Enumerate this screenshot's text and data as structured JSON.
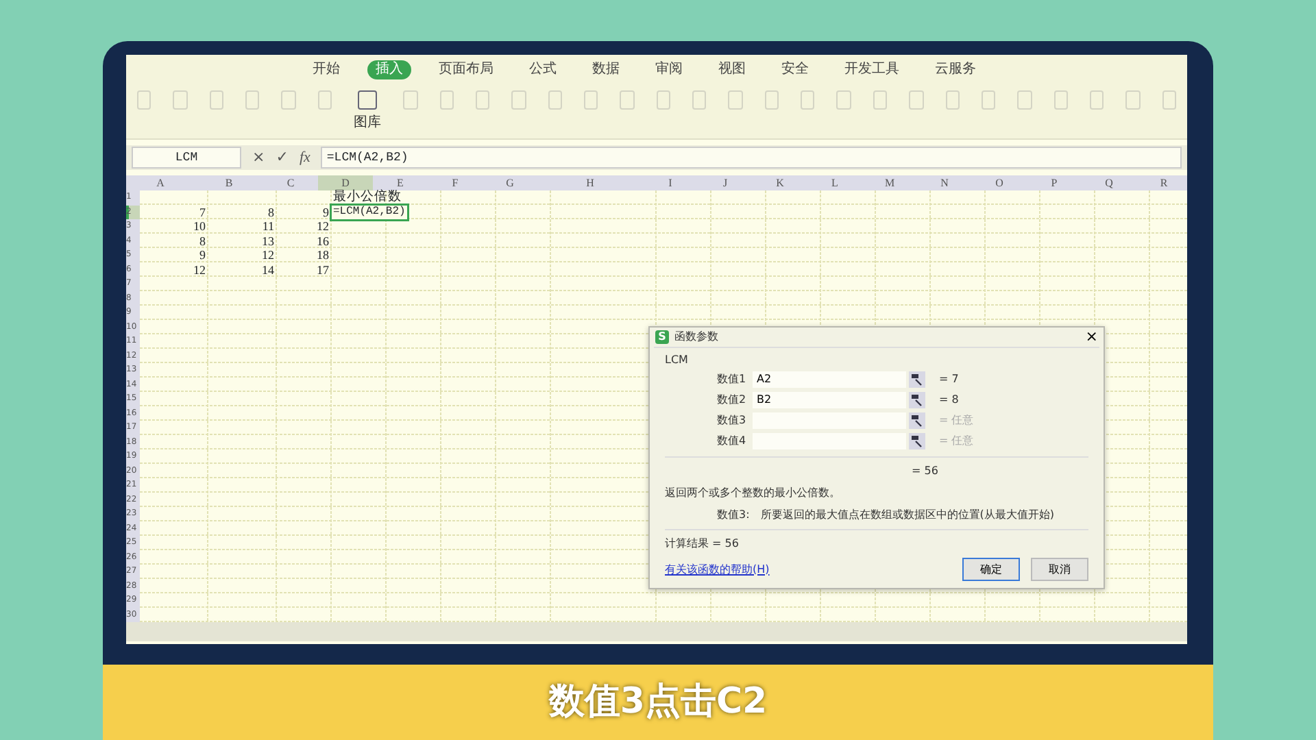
{
  "menu_tabs": [
    {
      "label": "开始",
      "selected": false
    },
    {
      "label": "插入",
      "selected": true
    },
    {
      "label": "页面布局",
      "selected": false
    },
    {
      "label": "公式",
      "selected": false
    },
    {
      "label": "数据",
      "selected": false
    },
    {
      "label": "审阅",
      "selected": false
    },
    {
      "label": "视图",
      "selected": false
    },
    {
      "label": "安全",
      "selected": false
    },
    {
      "label": "开发工具",
      "selected": false
    },
    {
      "label": "云服务",
      "selected": false
    }
  ],
  "ribbon": {
    "labels": [
      "图库"
    ]
  },
  "formula_bar": {
    "name_box": "LCM",
    "cancel": "×",
    "confirm": "✓",
    "fx": "fx",
    "formula": "=LCM(A2,B2)"
  },
  "sheet": {
    "columns": [
      {
        "label": "A",
        "selected": false
      },
      {
        "label": "B",
        "selected": false
      },
      {
        "label": "C",
        "selected": false
      },
      {
        "label": "D",
        "selected": true
      },
      {
        "label": "E",
        "selected": false
      },
      {
        "label": "F",
        "selected": false
      },
      {
        "label": "G",
        "selected": false
      },
      {
        "label": "H",
        "selected": false
      },
      {
        "label": "I",
        "selected": false
      },
      {
        "label": "J",
        "selected": false
      },
      {
        "label": "K",
        "selected": false
      },
      {
        "label": "L",
        "selected": false
      },
      {
        "label": "M",
        "selected": false
      },
      {
        "label": "N",
        "selected": false
      },
      {
        "label": "O",
        "selected": false
      },
      {
        "label": "P",
        "selected": false
      },
      {
        "label": "Q",
        "selected": false
      },
      {
        "label": "R",
        "selected": false
      }
    ],
    "rows": [
      {
        "header": "1",
        "selected": false,
        "cells": [
          null,
          null,
          null,
          {
            "text": "最小公倍数",
            "selected": false
          }
        ]
      },
      {
        "header": "2",
        "selected": true,
        "cells": [
          {
            "text": "7",
            "selected": false
          },
          {
            "text": "8",
            "selected": false
          },
          {
            "text": "9",
            "selected": false
          },
          {
            "text": "=LCM(A2,B2)",
            "selected": true
          }
        ]
      },
      {
        "header": "3",
        "selected": false,
        "cells": [
          {
            "text": "10",
            "selected": false
          },
          {
            "text": "11",
            "selected": false
          },
          {
            "text": "12",
            "selected": false
          }
        ]
      },
      {
        "header": "4",
        "selected": false,
        "cells": [
          {
            "text": "8",
            "selected": false
          },
          {
            "text": "13",
            "selected": false
          },
          {
            "text": "16",
            "selected": false
          }
        ]
      },
      {
        "header": "5",
        "selected": false,
        "cells": [
          {
            "text": "9",
            "selected": false
          },
          {
            "text": "12",
            "selected": false
          },
          {
            "text": "18",
            "selected": false
          }
        ]
      },
      {
        "header": "6",
        "selected": false,
        "cells": [
          {
            "text": "12",
            "selected": false
          },
          {
            "text": "14",
            "selected": false
          },
          {
            "text": "17",
            "selected": false
          }
        ]
      },
      {
        "header": "7",
        "selected": false,
        "cells": []
      },
      {
        "header": "8",
        "selected": false,
        "cells": []
      },
      {
        "header": "9",
        "selected": false,
        "cells": []
      },
      {
        "header": "10",
        "selected": false,
        "cells": []
      },
      {
        "header": "11",
        "selected": false,
        "cells": []
      },
      {
        "header": "12",
        "selected": false,
        "cells": []
      },
      {
        "header": "13",
        "selected": false,
        "cells": []
      },
      {
        "header": "14",
        "selected": false,
        "cells": []
      },
      {
        "header": "15",
        "selected": false,
        "cells": []
      },
      {
        "header": "16",
        "selected": false,
        "cells": []
      },
      {
        "header": "17",
        "selected": false,
        "cells": []
      },
      {
        "header": "18",
        "selected": false,
        "cells": []
      },
      {
        "header": "19",
        "selected": false,
        "cells": []
      },
      {
        "header": "20",
        "selected": false,
        "cells": []
      },
      {
        "header": "21",
        "selected": false,
        "cells": []
      },
      {
        "header": "22",
        "selected": false,
        "cells": []
      },
      {
        "header": "23",
        "selected": false,
        "cells": []
      },
      {
        "header": "24",
        "selected": false,
        "cells": []
      },
      {
        "header": "25",
        "selected": false,
        "cells": []
      },
      {
        "header": "26",
        "selected": false,
        "cells": []
      },
      {
        "header": "27",
        "selected": false,
        "cells": []
      },
      {
        "header": "28",
        "selected": false,
        "cells": []
      },
      {
        "header": "29",
        "selected": false,
        "cells": []
      },
      {
        "header": "30",
        "selected": false,
        "cells": []
      }
    ]
  },
  "dialog": {
    "icon_letter": "S",
    "title": "函数参数",
    "close": "×",
    "function_name": "LCM",
    "args": [
      {
        "label": "数值1",
        "value": "A2",
        "result": "= 7",
        "dimmed": false
      },
      {
        "label": "数值2",
        "value": "B2",
        "result": "= 8",
        "dimmed": false
      },
      {
        "label": "数值3",
        "result": "= 任意",
        "dimmed": true
      },
      {
        "label": "数值4",
        "result": "= 任意",
        "dimmed": true
      }
    ],
    "result_line": "= 56",
    "description": "返回两个或多个整数的最小公倍数。",
    "arg_help_label": "数值3:",
    "arg_help": "所要返回的最大值点在数组或数据区中的位置(从最大值开始)",
    "calc_result": "计算结果 =  56",
    "help_link": "有关该函数的帮助(H)",
    "buttons": [
      {
        "label": "确定",
        "default": true
      },
      {
        "label": "取消",
        "default": false
      }
    ]
  },
  "subtitle": "数值3点击C2"
}
